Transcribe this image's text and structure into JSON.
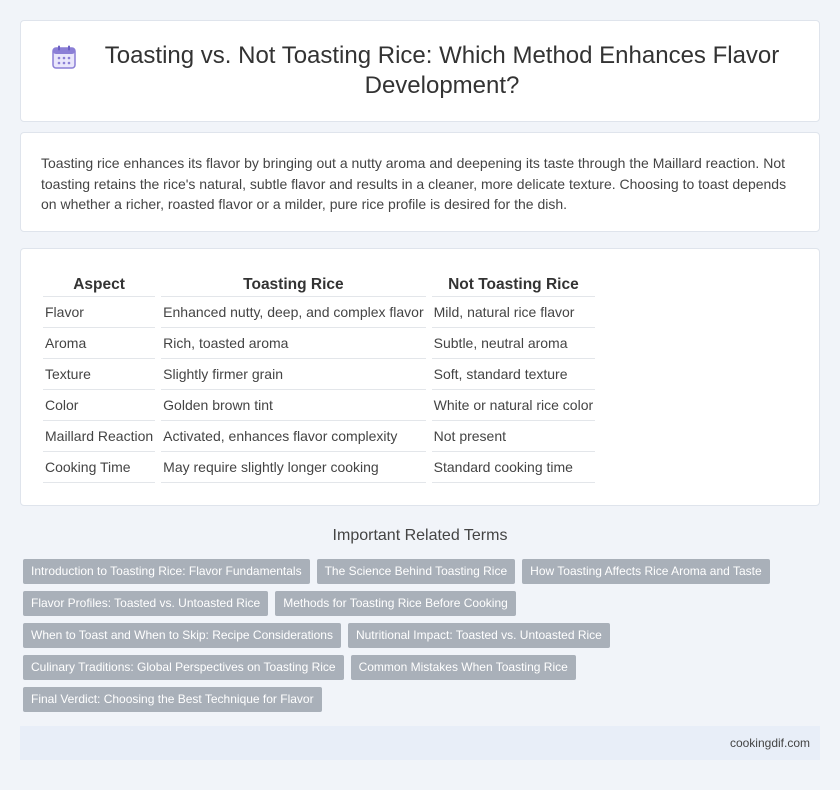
{
  "header": {
    "title": "Toasting vs. Not Toasting Rice: Which Method Enhances Flavor Development?",
    "icon": "calendar-icon"
  },
  "intro": {
    "text": "Toasting rice enhances its flavor by bringing out a nutty aroma and deepening its taste through the Maillard reaction. Not toasting retains the rice's natural, subtle flavor and results in a cleaner, more delicate texture. Choosing to toast depends on whether a richer, roasted flavor or a milder, pure rice profile is desired for the dish."
  },
  "table": {
    "headers": [
      "Aspect",
      "Toasting Rice",
      "Not Toasting Rice"
    ],
    "rows": [
      [
        "Flavor",
        "Enhanced nutty, deep, and complex flavor",
        "Mild, natural rice flavor"
      ],
      [
        "Aroma",
        "Rich, toasted aroma",
        "Subtle, neutral aroma"
      ],
      [
        "Texture",
        "Slightly firmer grain",
        "Soft, standard texture"
      ],
      [
        "Color",
        "Golden brown tint",
        "White or natural rice color"
      ],
      [
        "Maillard Reaction",
        "Activated, enhances flavor complexity",
        "Not present"
      ],
      [
        "Cooking Time",
        "May require slightly longer cooking",
        "Standard cooking time"
      ]
    ]
  },
  "related": {
    "title": "Important Related Terms",
    "tags": [
      "Introduction to Toasting Rice: Flavor Fundamentals",
      "The Science Behind Toasting Rice",
      "How Toasting Affects Rice Aroma and Taste",
      "Flavor Profiles: Toasted vs. Untoasted Rice",
      "Methods for Toasting Rice Before Cooking",
      "When to Toast and When to Skip: Recipe Considerations",
      "Nutritional Impact: Toasted vs. Untoasted Rice",
      "Culinary Traditions: Global Perspectives on Toasting Rice",
      "Common Mistakes When Toasting Rice",
      "Final Verdict: Choosing the Best Technique for Flavor"
    ]
  },
  "footer": {
    "site": "cookingdif.com"
  },
  "colors": {
    "background": "#f1f4f9",
    "tag": "#a9b0b9",
    "footer": "#e8eef8",
    "icon": "#8b7fd6"
  }
}
